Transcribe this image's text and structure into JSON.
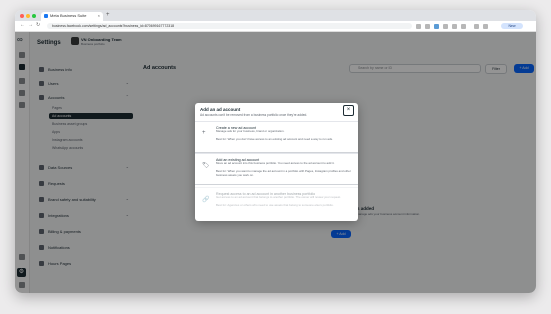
{
  "browser": {
    "tab_title": "Meta Business Suite",
    "tab_close": "×",
    "new_tab": "+",
    "url": "business.facebook.com/settings/ad_accounts?business_id=870699167772318",
    "profile_button": "New",
    "nav_back": "←",
    "nav_forward": "→",
    "nav_reload": "↻"
  },
  "app": {
    "settings_title": "Settings",
    "business_name": "VN Onboarding Team",
    "business_sub": "Business portfolio"
  },
  "sidebar": {
    "items": [
      {
        "label": "Business info",
        "chevron": ""
      },
      {
        "label": "Users",
        "chevron": "⌄"
      },
      {
        "label": "Accounts",
        "chevron": "⌃"
      }
    ],
    "sub_items": [
      {
        "label": "Pages"
      },
      {
        "label": "Ad accounts"
      },
      {
        "label": "Business asset groups"
      },
      {
        "label": "Apps"
      },
      {
        "label": "Instagram accounts"
      },
      {
        "label": "WhatsApp accounts"
      }
    ],
    "items_after": [
      {
        "label": "Data Sources",
        "chevron": "⌄"
      },
      {
        "label": "Requests",
        "chevron": ""
      },
      {
        "label": "Brand safety and suitability",
        "chevron": "⌄"
      },
      {
        "label": "Integrations",
        "chevron": "⌄"
      },
      {
        "label": "Billing & payments",
        "chevron": ""
      },
      {
        "label": "Notifications",
        "chevron": ""
      },
      {
        "label": "Hours Pages",
        "chevron": ""
      }
    ]
  },
  "main": {
    "title": "Ad accounts",
    "search_placeholder": "Search by name or ID",
    "filter_label": "Filter",
    "add_label": "+ Add",
    "empty_title": "No ad accounts added",
    "empty_desc": "Add the ad accounts in this business portfolio so you can manage ads your business account information.",
    "empty_add": "+ Add"
  },
  "modal": {
    "title": "Add an ad account",
    "subtitle": "Ad accounts can't be removed from a business portfolio once they're added.",
    "close": "×",
    "options": [
      {
        "icon": "+",
        "title": "Create a new ad account",
        "desc": "Manage ads for your business, brand or organization.",
        "note": "Best for: When you don't have access to an existing ad account and need a way to run ads."
      },
      {
        "icon": "🏷",
        "title": "Add an existing ad account",
        "desc": "Move an ad account into this business portfolio. You need access to the ad account to add it.",
        "note": "Best for: When you want to manage the ad account in a portfolio with Pages, Instagram profiles and other business assets you work on."
      },
      {
        "icon": "🔗",
        "title": "Request access to an ad account in another business portfolio",
        "desc": "Get access to an ad account that belongs to another portfolio. The owner will review your request.",
        "note": "Best for: Agencies or others who need to use assets that belong to someone else's portfolio."
      }
    ]
  }
}
